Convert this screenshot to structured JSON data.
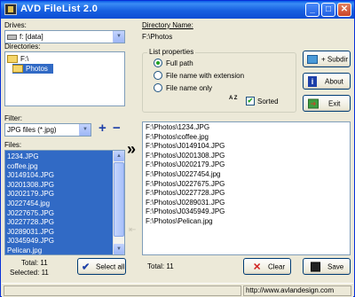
{
  "window": {
    "title": "AVD FileList 2.0"
  },
  "drives": {
    "label": "Drives:",
    "value": "f: [data]"
  },
  "directories": {
    "label": "Directories:",
    "items": [
      {
        "name": "F:\\",
        "selected": false
      },
      {
        "name": "Photos",
        "selected": true
      }
    ]
  },
  "filter": {
    "label": "Filter:",
    "value": "JPG files (*.jpg)",
    "add_symbol": "+",
    "remove_symbol": "−"
  },
  "files": {
    "label": "Files:",
    "items": [
      "1234.JPG",
      "coffee.jpg",
      "J0149104.JPG",
      "J0201308.JPG",
      "J0202179.JPG",
      "J0227454.jpg",
      "J0227675.JPG",
      "J0227728.JPG",
      "J0289031.JPG",
      "J0345949.JPG",
      "Pelican.jpg"
    ],
    "total_text": "Total: 11",
    "selected_text": "Selected: 11",
    "select_all_label": "Select all"
  },
  "transfer": {
    "label": "»"
  },
  "directory_name": {
    "label": "Directory Name:",
    "value": "F:\\Photos"
  },
  "list_properties": {
    "title": "List properties",
    "options": [
      {
        "label": "Full path",
        "checked": true
      },
      {
        "label": "File name with extension",
        "checked": false
      },
      {
        "label": "File name only",
        "checked": false
      }
    ],
    "sort_icon": "A Z",
    "sorted_label": "Sorted",
    "sorted_checked": true
  },
  "buttons": {
    "subdir": "+ Subdir",
    "about": "About",
    "exit": "Exit",
    "clear": "Clear",
    "save": "Save"
  },
  "output": {
    "items": [
      "F:\\Photos\\1234.JPG",
      "F:\\Photos\\coffee.jpg",
      "F:\\Photos\\J0149104.JPG",
      "F:\\Photos\\J0201308.JPG",
      "F:\\Photos\\J0202179.JPG",
      "F:\\Photos\\J0227454.jpg",
      "F:\\Photos\\J0227675.JPG",
      "F:\\Photos\\J0227728.JPG",
      "F:\\Photos\\J0289031.JPG",
      "F:\\Photos\\J0345949.JPG",
      "F:\\Photos\\Pelican.jpg"
    ],
    "total_text": "Total: 11"
  },
  "status": {
    "url": "http://www.avlandesign.com"
  },
  "colors": {
    "selection": "#316ac5",
    "title_bar": "#0a5ce6",
    "window_bg": "#ece9d8",
    "add_icon": "#1d3fa8"
  }
}
